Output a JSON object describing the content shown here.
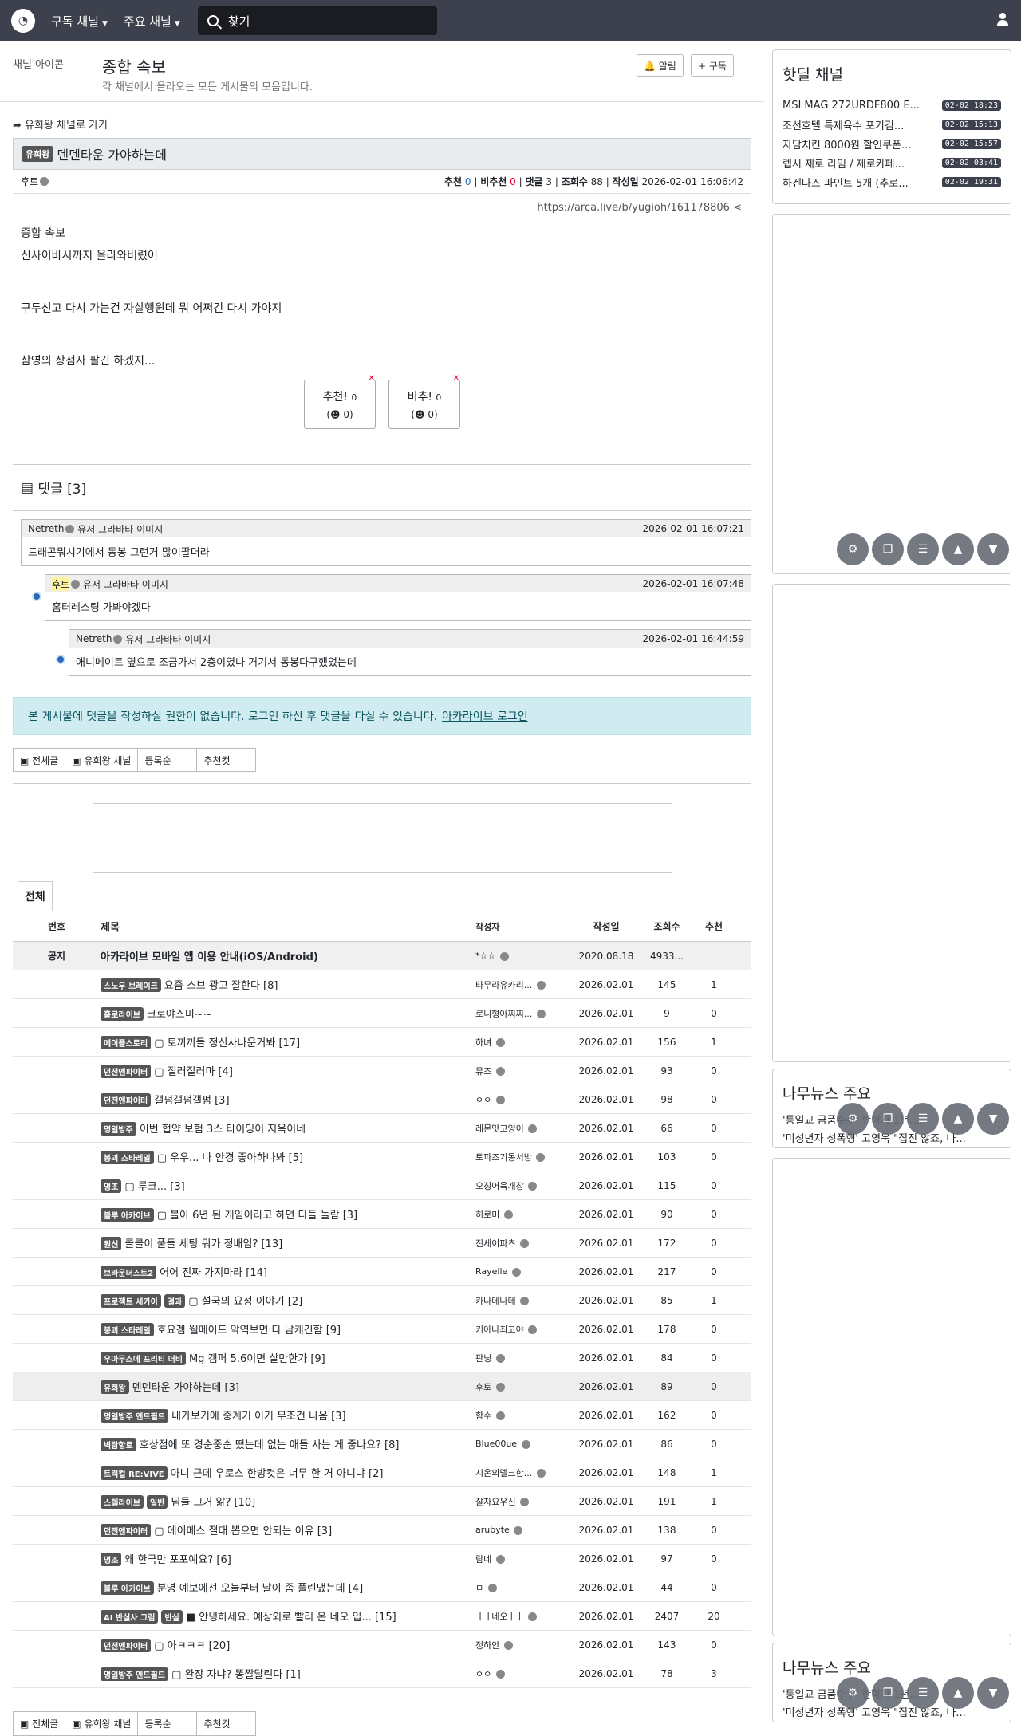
{
  "topbar": {
    "sub_channels": "구독 채널",
    "main_channels": "주요 채널",
    "search_placeholder": "찾기"
  },
  "channel": {
    "icon_alt": "채널 아이콘",
    "title": "종합 속보",
    "desc": "각 채널에서 올라오는 모든 게시물의 모음입니다.",
    "alarm": "알림",
    "subscribe": "구독"
  },
  "post": {
    "back": "유희왕 채널로 가기",
    "badge": "유희왕",
    "title": "덴덴타운 가야하는데",
    "author": "후토",
    "rec_label": "추천",
    "rec": "0",
    "nrec_label": "비추천",
    "nrec": "0",
    "cmt_label": "댓글",
    "cmt": "3",
    "view_label": "조회수",
    "views": "88",
    "date_label": "작성일",
    "date": "2026-02-01 16:06:42",
    "url": "https://arca.live/b/yugioh/161178806",
    "img_alt": "종합 속보",
    "p1": "신사이바시까지 올라와버렸어",
    "p2": "구두신고 다시 가는건 자살행윈데 뭐 어쩌긴 다시 가야지",
    "p3": "삼영의 상점사 팔긴 하겠지...",
    "up": "추천!",
    "up_n": "0",
    "up_sub": "(☻ 0)",
    "down": "비추!",
    "down_n": "0",
    "down_sub": "(☻ 0)"
  },
  "comments": {
    "header": "댓글 [3]",
    "items": [
      {
        "author": "Netreth",
        "avatar": "유저 그라바타 이미지",
        "date": "2026-02-01 16:07:21",
        "text": "드래곤뭐시기에서 동봉 그런거 많이팔더라"
      },
      {
        "author": "후토",
        "avatar": "유저 그라바타 이미지",
        "date": "2026-02-01 16:07:48",
        "text": "홈터레스팅 가봐야겠다"
      },
      {
        "author": "Netreth",
        "avatar": "유저 그라바타 이미지",
        "date": "2026-02-01 16:44:59",
        "text": "애니메이트 옆으로 조금가서 2층이였나 거기서 동봉다구했었는데"
      }
    ],
    "notice": "본 게시물에 댓글을 작성하실 권한이 없습니다. 로그인 하신 후 댓글을 다실 수 있습니다.",
    "login": "아카라이브 로그인"
  },
  "tabs": [
    "전체글",
    "유희왕 채널",
    "등록순",
    "추천컷"
  ],
  "list": {
    "tab": "전체",
    "headers": [
      "번호",
      "제목",
      "작성자",
      "작성일",
      "조회수",
      "추천"
    ],
    "rows": [
      {
        "no": "공지",
        "badges": [],
        "title": "아카라이브 모바일 앱 이용 안내(iOS/Android)",
        "author": "*☆☆",
        "date": "2020.08.18",
        "views": "4933...",
        "rec": "",
        "notice": true
      },
      {
        "no": "",
        "badges": [
          "스노우 브레이크"
        ],
        "title": "요즘 스브 광고 잘한다 [8]",
        "author": "타무라유카리...",
        "date": "2026.02.01",
        "views": "145",
        "rec": "1"
      },
      {
        "no": "",
        "badges": [
          "홀로라이브"
        ],
        "title": "크로야스미~~",
        "author": "로니형아찌찌...",
        "date": "2026.02.01",
        "views": "9",
        "rec": "0"
      },
      {
        "no": "",
        "badges": [
          "메이플스토리"
        ],
        "title": "▢ 토끼끼들 정신사나운거봐 [17]",
        "author": "하녀",
        "date": "2026.02.01",
        "views": "156",
        "rec": "1"
      },
      {
        "no": "",
        "badges": [
          "던전앤파이터"
        ],
        "title": "▢ 질러질러마 [4]",
        "author": "뮤즈",
        "date": "2026.02.01",
        "views": "93",
        "rec": "0"
      },
      {
        "no": "",
        "badges": [
          "던전앤파이터"
        ],
        "title": "갤펌갤펌갤펌 [3]",
        "author": "ㅇㅇ",
        "date": "2026.02.01",
        "views": "98",
        "rec": "0"
      },
      {
        "no": "",
        "badges": [
          "명일방주"
        ],
        "title": "이번 협약 보험 3스 타이밍이 지옥이네",
        "author": "레몬맛고양이",
        "date": "2026.02.01",
        "views": "66",
        "rec": "0"
      },
      {
        "no": "",
        "badges": [
          "붕괴 스타레일"
        ],
        "title": "▢ 우우... 나 안경 좋아하나봐 [5]",
        "author": "토파즈기동서방",
        "date": "2026.02.01",
        "views": "103",
        "rec": "0"
      },
      {
        "no": "",
        "badges": [
          "명조"
        ],
        "title": "▢ 루크... [3]",
        "author": "오징어육개장",
        "date": "2026.02.01",
        "views": "115",
        "rec": "0"
      },
      {
        "no": "",
        "badges": [
          "블루 아카이브"
        ],
        "title": "▢ 블아 6년 된 게임이라고 하면 다들 놀람 [3]",
        "author": "히로미",
        "date": "2026.02.01",
        "views": "90",
        "rec": "0"
      },
      {
        "no": "",
        "badges": [
          "원신"
        ],
        "title": "콜콜이 풀돌 세팅 뭐가 정배임? [13]",
        "author": "진세이파츠",
        "date": "2026.02.01",
        "views": "172",
        "rec": "0"
      },
      {
        "no": "",
        "badges": [
          "브라운더스트2"
        ],
        "title": "어어 진짜 가지마라 [14]",
        "author": "Rayelle",
        "date": "2026.02.01",
        "views": "217",
        "rec": "0"
      },
      {
        "no": "",
        "badges": [
          "프로젝트 세카이",
          "결과"
        ],
        "title": "▢ 설국의 요정 이야기 [2]",
        "author": "카나데나데",
        "date": "2026.02.01",
        "views": "85",
        "rec": "1"
      },
      {
        "no": "",
        "badges": [
          "붕괴 스타레일"
        ],
        "title": "호요겜 웰메이드 악역보면 다 남캐긴함 [9]",
        "author": "키아나최고야",
        "date": "2026.02.01",
        "views": "178",
        "rec": "0"
      },
      {
        "no": "",
        "badges": [
          "우마무스메 프리티 더비"
        ],
        "title": "Mg 캠퍼 5.6이면 살만한가 [9]",
        "author": "판닝",
        "date": "2026.02.01",
        "views": "84",
        "rec": "0"
      },
      {
        "no": "",
        "badges": [
          "유희왕"
        ],
        "title": "덴덴타운 가야하는데 [3]",
        "author": "후토",
        "date": "2026.02.01",
        "views": "89",
        "rec": "0",
        "current": true
      },
      {
        "no": "",
        "badges": [
          "명일방주 엔드필드"
        ],
        "title": "내가보기에 중계기 이거 무조건 나옴 [3]",
        "author": "함수",
        "date": "2026.02.01",
        "views": "162",
        "rec": "0"
      },
      {
        "no": "",
        "badges": [
          "벽람항로"
        ],
        "title": "호상점에 또 경순중순 떴는데 없는 애들 사는 게 좋나요? [8]",
        "author": "Blue00ue",
        "date": "2026.02.01",
        "views": "86",
        "rec": "0"
      },
      {
        "no": "",
        "badges": [
          "트릭컬 RE:VIVE"
        ],
        "title": "아니 근데 우로스 한방컷은 너무 한 거 아니냐 [2]",
        "author": "시온의델크한...",
        "date": "2026.02.01",
        "views": "148",
        "rec": "1"
      },
      {
        "no": "",
        "badges": [
          "스텔라이브",
          "일반"
        ],
        "title": "님들 그거 앎? [10]",
        "author": "잘자요우신",
        "date": "2026.02.01",
        "views": "191",
        "rec": "1"
      },
      {
        "no": "",
        "badges": [
          "던전앤파이터"
        ],
        "title": "▢ 에이메스 절대 뽑으면 안되는 이유 [3]",
        "author": "arubyte",
        "date": "2026.02.01",
        "views": "138",
        "rec": "0"
      },
      {
        "no": "",
        "badges": [
          "명조"
        ],
        "title": "왜 한국만 포포예요? [6]",
        "author": "람네",
        "date": "2026.02.01",
        "views": "97",
        "rec": "0"
      },
      {
        "no": "",
        "badges": [
          "블루 아카이브"
        ],
        "title": "분명 예보에선 오늘부터 날이 좀 풀린댔는데 [4]",
        "author": "ㅁ",
        "date": "2026.02.01",
        "views": "44",
        "rec": "0"
      },
      {
        "no": "",
        "badges": [
          "AI 반실사 그림",
          "반실"
        ],
        "title": "■ 안녕하세요. 예상외로 빨리 온 네오 입... [15]",
        "author": "ㅓㅓ네오ㅏㅏ",
        "date": "2026.02.01",
        "views": "2407",
        "rec": "20"
      },
      {
        "no": "",
        "badges": [
          "던전앤파이터"
        ],
        "title": "▢ 아ㅋㅋㅋ [20]",
        "author": "정하안",
        "date": "2026.02.01",
        "views": "143",
        "rec": "0"
      },
      {
        "no": "",
        "badges": [
          "명일방주 엔드필드"
        ],
        "title": "▢ 완장 자냐? 똥짤달린다 [1]",
        "author": "ㅇㅇ",
        "date": "2026.02.01",
        "views": "78",
        "rec": "3"
      }
    ]
  },
  "side": {
    "hot_title": "핫딜 채널",
    "hot": [
      {
        "t": "MSI MAG 272URDF800 E...",
        "tm": "02-02 18:23"
      },
      {
        "t": "조선호텔 특제육수 포기김...",
        "tm": "02-02 15:13"
      },
      {
        "t": "자담치킨 8000원 할인쿠폰...",
        "tm": "02-02 15:57"
      },
      {
        "t": "렙시 제로 라임 / 제로카페...",
        "tm": "02-02 03:41"
      },
      {
        "t": "하겐다즈 파인트 5개 (추로...",
        "tm": "02-02 19:31"
      }
    ],
    "news_title": "나무뉴스 주요",
    "news": [
      "'통일교 금품수수' 한학자 1년...",
      "'미성년자 성폭행' 고영욱 \"집진 않죠, 나..."
    ]
  }
}
